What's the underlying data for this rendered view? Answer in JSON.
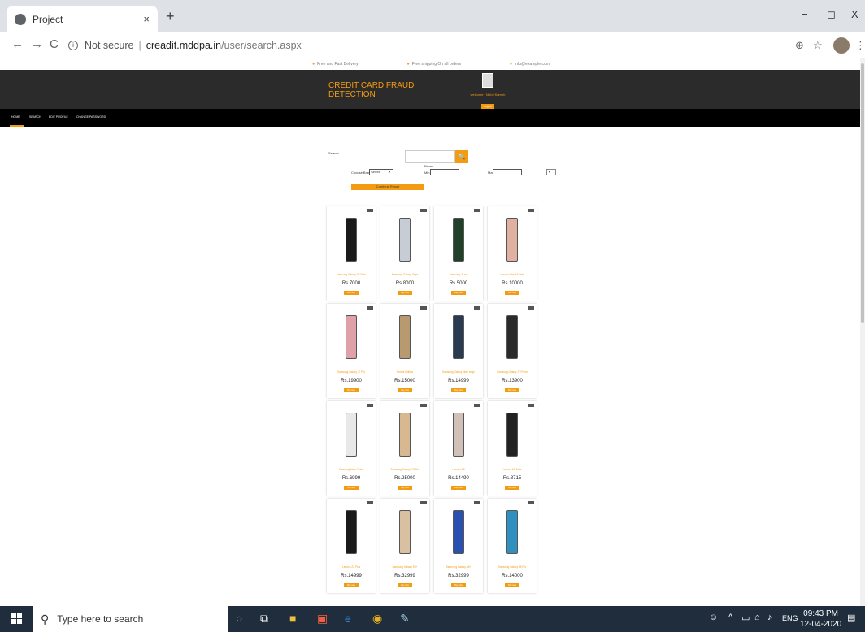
{
  "browser": {
    "tab_title": "Project",
    "tab_close": "×",
    "new_tab": "+",
    "minimize": "−",
    "maximize": "◻",
    "close": "X",
    "security_label": "Not secure",
    "url_host": "creadit.mddpa.in",
    "url_path": "/user/search.aspx",
    "back": "←",
    "forward": "→",
    "reload": "C",
    "zoom_icon": "⊕",
    "star_icon": "☆",
    "menu_icon": "⋮"
  },
  "site": {
    "topline": [
      "Free and Fast Delivery",
      "Free shipping On all orders",
      "info@example.com"
    ],
    "brand": "CREDIT CARD FRAUD DETECTION",
    "welcome": "welcome : Nikhil Kumbh",
    "logout": "Logout",
    "menu": [
      "HOME",
      "SEARCH",
      "EDIT PROFILE",
      "CHANGE PASSWORD"
    ],
    "search_label": "Search",
    "search_btn_icon": "🔍",
    "filters": {
      "prices_label": "Prices",
      "choose_brand_label": "Choose Brand",
      "brand_value": "Select",
      "min_label": "Min",
      "max_label": "Max",
      "dropdown_arrow": "▼",
      "combine_label": "Combine Result"
    },
    "products": [
      {
        "name": "Samsung Galaxy S10 Pro",
        "price": "Rs.7000",
        "buy": "Buy now",
        "color": "#1a1a1a"
      },
      {
        "name": "Samsung Galaxy Onyx",
        "price": "Rs.8000",
        "buy": "Buy now",
        "color": "#c8ccd4"
      },
      {
        "name": "Samsung J5 ext",
        "price": "Rs.5000",
        "buy": "Buy now",
        "color": "#20402a"
      },
      {
        "name": "Lenovo Vibe K5 Note",
        "price": "Rs.10000",
        "buy": "Buy now",
        "color": "#e0b0a0"
      },
      {
        "name": "Samsung Galaxy J7 Pro",
        "price": "Rs.19900",
        "buy": "Buy now",
        "color": "#e0a0a8"
      },
      {
        "name": "Redmi Aldilaw",
        "price": "Rs.15000",
        "buy": "Buy now",
        "color": "#b89a70"
      },
      {
        "name": "Samsung Galaxy Note edge",
        "price": "Rs.14999",
        "buy": "Buy now",
        "color": "#2a3a50"
      },
      {
        "name": "Samsung Galaxy J7 Prime",
        "price": "Rs.13900",
        "buy": "Buy now",
        "color": "#2a2a2a"
      },
      {
        "name": "Samsung Note 3 Neo",
        "price": "Rs.6999",
        "buy": "Buy now",
        "color": "#e8e8e8"
      },
      {
        "name": "Samsung Galaxy C9 Pro",
        "price": "Rs.25000",
        "buy": "Buy now",
        "color": "#d8b890"
      },
      {
        "name": "Lenovo K5",
        "price": "Rs.14490",
        "buy": "Buy now",
        "color": "#d0c0b8"
      },
      {
        "name": "Lenovo K8 Note",
        "price": "Rs.8715",
        "buy": "Buy now",
        "color": "#222222"
      },
      {
        "name": "Lenovo Z2 Plus",
        "price": "Rs.14999",
        "buy": "Buy now",
        "color": "#1a1a1a"
      },
      {
        "name": "Samsung Galaxy S9+",
        "price": "Rs.32999",
        "buy": "Buy now",
        "color": "#d8c0a0"
      },
      {
        "name": "Samsung Galaxy A8+",
        "price": "Rs.32999",
        "buy": "Buy now",
        "color": "#2a50b0"
      },
      {
        "name": "Samsung Galaxy J8 Pro",
        "price": "Rs.14000",
        "buy": "Buy now",
        "color": "#3090c0"
      }
    ]
  },
  "taskbar": {
    "search_placeholder": "Type here to search",
    "language": "ENG",
    "time": "09:43 PM",
    "date": "12-04-2020"
  }
}
